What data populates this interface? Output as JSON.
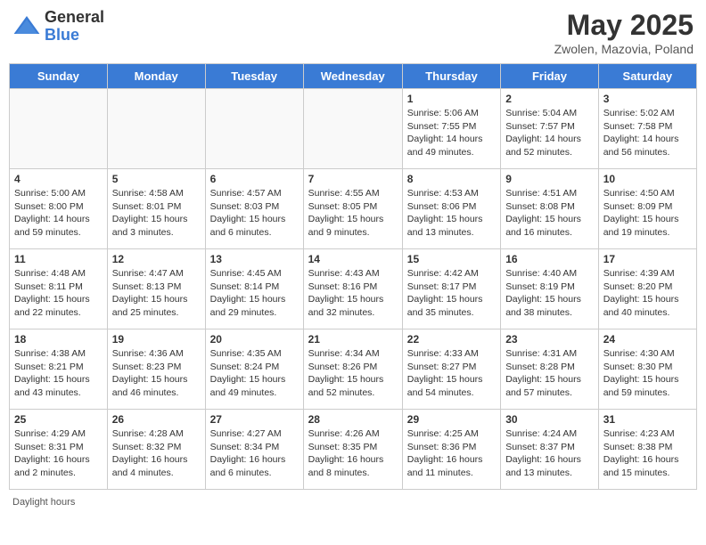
{
  "header": {
    "logo_general": "General",
    "logo_blue": "Blue",
    "month_title": "May 2025",
    "subtitle": "Zwolen, Mazovia, Poland"
  },
  "days_of_week": [
    "Sunday",
    "Monday",
    "Tuesday",
    "Wednesday",
    "Thursday",
    "Friday",
    "Saturday"
  ],
  "weeks": [
    [
      {
        "day": "",
        "info": ""
      },
      {
        "day": "",
        "info": ""
      },
      {
        "day": "",
        "info": ""
      },
      {
        "day": "",
        "info": ""
      },
      {
        "day": "1",
        "info": "Sunrise: 5:06 AM\nSunset: 7:55 PM\nDaylight: 14 hours and 49 minutes."
      },
      {
        "day": "2",
        "info": "Sunrise: 5:04 AM\nSunset: 7:57 PM\nDaylight: 14 hours and 52 minutes."
      },
      {
        "day": "3",
        "info": "Sunrise: 5:02 AM\nSunset: 7:58 PM\nDaylight: 14 hours and 56 minutes."
      }
    ],
    [
      {
        "day": "4",
        "info": "Sunrise: 5:00 AM\nSunset: 8:00 PM\nDaylight: 14 hours and 59 minutes."
      },
      {
        "day": "5",
        "info": "Sunrise: 4:58 AM\nSunset: 8:01 PM\nDaylight: 15 hours and 3 minutes."
      },
      {
        "day": "6",
        "info": "Sunrise: 4:57 AM\nSunset: 8:03 PM\nDaylight: 15 hours and 6 minutes."
      },
      {
        "day": "7",
        "info": "Sunrise: 4:55 AM\nSunset: 8:05 PM\nDaylight: 15 hours and 9 minutes."
      },
      {
        "day": "8",
        "info": "Sunrise: 4:53 AM\nSunset: 8:06 PM\nDaylight: 15 hours and 13 minutes."
      },
      {
        "day": "9",
        "info": "Sunrise: 4:51 AM\nSunset: 8:08 PM\nDaylight: 15 hours and 16 minutes."
      },
      {
        "day": "10",
        "info": "Sunrise: 4:50 AM\nSunset: 8:09 PM\nDaylight: 15 hours and 19 minutes."
      }
    ],
    [
      {
        "day": "11",
        "info": "Sunrise: 4:48 AM\nSunset: 8:11 PM\nDaylight: 15 hours and 22 minutes."
      },
      {
        "day": "12",
        "info": "Sunrise: 4:47 AM\nSunset: 8:13 PM\nDaylight: 15 hours and 25 minutes."
      },
      {
        "day": "13",
        "info": "Sunrise: 4:45 AM\nSunset: 8:14 PM\nDaylight: 15 hours and 29 minutes."
      },
      {
        "day": "14",
        "info": "Sunrise: 4:43 AM\nSunset: 8:16 PM\nDaylight: 15 hours and 32 minutes."
      },
      {
        "day": "15",
        "info": "Sunrise: 4:42 AM\nSunset: 8:17 PM\nDaylight: 15 hours and 35 minutes."
      },
      {
        "day": "16",
        "info": "Sunrise: 4:40 AM\nSunset: 8:19 PM\nDaylight: 15 hours and 38 minutes."
      },
      {
        "day": "17",
        "info": "Sunrise: 4:39 AM\nSunset: 8:20 PM\nDaylight: 15 hours and 40 minutes."
      }
    ],
    [
      {
        "day": "18",
        "info": "Sunrise: 4:38 AM\nSunset: 8:21 PM\nDaylight: 15 hours and 43 minutes."
      },
      {
        "day": "19",
        "info": "Sunrise: 4:36 AM\nSunset: 8:23 PM\nDaylight: 15 hours and 46 minutes."
      },
      {
        "day": "20",
        "info": "Sunrise: 4:35 AM\nSunset: 8:24 PM\nDaylight: 15 hours and 49 minutes."
      },
      {
        "day": "21",
        "info": "Sunrise: 4:34 AM\nSunset: 8:26 PM\nDaylight: 15 hours and 52 minutes."
      },
      {
        "day": "22",
        "info": "Sunrise: 4:33 AM\nSunset: 8:27 PM\nDaylight: 15 hours and 54 minutes."
      },
      {
        "day": "23",
        "info": "Sunrise: 4:31 AM\nSunset: 8:28 PM\nDaylight: 15 hours and 57 minutes."
      },
      {
        "day": "24",
        "info": "Sunrise: 4:30 AM\nSunset: 8:30 PM\nDaylight: 15 hours and 59 minutes."
      }
    ],
    [
      {
        "day": "25",
        "info": "Sunrise: 4:29 AM\nSunset: 8:31 PM\nDaylight: 16 hours and 2 minutes."
      },
      {
        "day": "26",
        "info": "Sunrise: 4:28 AM\nSunset: 8:32 PM\nDaylight: 16 hours and 4 minutes."
      },
      {
        "day": "27",
        "info": "Sunrise: 4:27 AM\nSunset: 8:34 PM\nDaylight: 16 hours and 6 minutes."
      },
      {
        "day": "28",
        "info": "Sunrise: 4:26 AM\nSunset: 8:35 PM\nDaylight: 16 hours and 8 minutes."
      },
      {
        "day": "29",
        "info": "Sunrise: 4:25 AM\nSunset: 8:36 PM\nDaylight: 16 hours and 11 minutes."
      },
      {
        "day": "30",
        "info": "Sunrise: 4:24 AM\nSunset: 8:37 PM\nDaylight: 16 hours and 13 minutes."
      },
      {
        "day": "31",
        "info": "Sunrise: 4:23 AM\nSunset: 8:38 PM\nDaylight: 16 hours and 15 minutes."
      }
    ]
  ],
  "footer": {
    "daylight_label": "Daylight hours"
  }
}
